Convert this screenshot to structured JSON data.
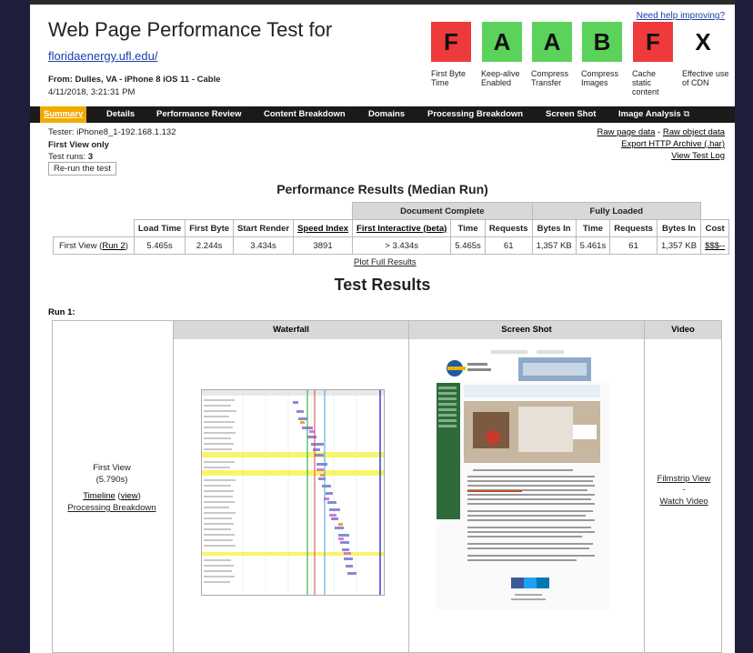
{
  "header": {
    "title": "Web Page Performance Test for",
    "url": "floridaenergy.ufl.edu/",
    "from": "From: Dulles, VA - iPhone 8 iOS 11 - Cable",
    "date": "4/11/2018, 3:21:31 PM",
    "help_link": "Need help improving?"
  },
  "grades": [
    {
      "letter": "F",
      "label": "First Byte Time",
      "color": "#ee3a3a"
    },
    {
      "letter": "A",
      "label": "Keep-alive Enabled",
      "color": "#5bd35b"
    },
    {
      "letter": "A",
      "label": "Compress Transfer",
      "color": "#5bd35b"
    },
    {
      "letter": "B",
      "label": "Compress Images",
      "color": "#5bd35b"
    },
    {
      "letter": "F",
      "label": "Cache static content",
      "color": "#ee3a3a"
    },
    {
      "letter": "X",
      "label": "Effective use of CDN",
      "color": "#ffffff"
    }
  ],
  "nav": {
    "items": [
      "Summary",
      "Details",
      "Performance Review",
      "Content Breakdown",
      "Domains",
      "Processing Breakdown",
      "Screen Shot",
      "Image Analysis"
    ]
  },
  "test_info": {
    "tester": "Tester: iPhone8_1-192.168.1.132",
    "first_view": "First View only",
    "runs_label": "Test runs: ",
    "runs_value": "3",
    "rerun_button": "Re-run the test",
    "raw_page": "Raw page data",
    "dash": " - ",
    "raw_object": "Raw object data",
    "export": "Export HTTP Archive (.har)",
    "view_log": "View Test Log"
  },
  "perf": {
    "title": "Performance Results (Median Run)",
    "group_doc": "Document Complete",
    "group_full": "Fully Loaded",
    "headers": [
      "Load Time",
      "First Byte",
      "Start Render",
      "Speed Index",
      "First Interactive (beta)",
      "Time",
      "Requests",
      "Bytes In",
      "Time",
      "Requests",
      "Bytes In",
      "Cost"
    ],
    "row_label": "First View (",
    "row_link": "Run 2",
    "row_label_end": ")",
    "values": [
      "5.465s",
      "2.244s",
      "3.434s",
      "3891",
      "> 3.434s",
      "5.465s",
      "61",
      "1,357 KB",
      "5.461s",
      "61",
      "1,357 KB",
      "$$$--"
    ],
    "plot_link": "Plot Full Results"
  },
  "results": {
    "title": "Test Results",
    "run_label": "Run 1:",
    "col_waterfall": "Waterfall",
    "col_screenshot": "Screen Shot",
    "col_video": "Video",
    "first_view": "First View",
    "first_view_time": "(5.790s)",
    "timeline": "Timeline",
    "view_paren_open": " (",
    "view": "view",
    "view_paren_close": ")",
    "processing": "Processing Breakdown",
    "filmstrip": "Filmstrip View",
    "dash": "-",
    "watch": "Watch Video"
  }
}
